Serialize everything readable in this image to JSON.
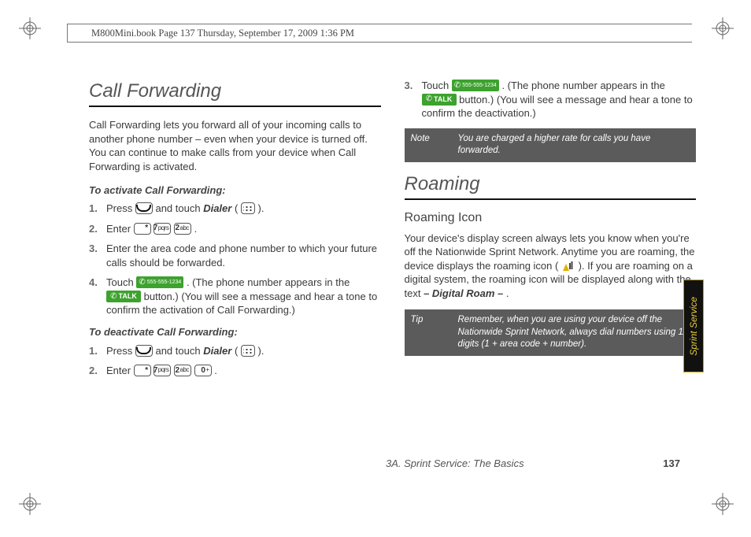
{
  "header_stamp": "M800Mini.book  Page 137  Thursday, September 17, 2009  1:36 PM",
  "left": {
    "title": "Call Forwarding",
    "intro": "Call Forwarding lets you forward all of your incoming calls to another phone number – even when your device is turned off. You can continue to make calls from your device when Call Forwarding is activated.",
    "activate_head": "To activate Call Forwarding:",
    "act": {
      "s1a": "Press ",
      "s1b": " and touch ",
      "s1c": "Dialer",
      "s1d": " (",
      "s1e": ").",
      "s2a": "Enter ",
      "s2b": ".",
      "s3": "Enter the area code and phone number to which your future calls should be forwarded.",
      "s4a": "Touch ",
      "s4b": ". (The phone number appears in the ",
      "s4c": " button.) (You will see a message and hear a tone to confirm the activation of Call Forwarding.)"
    },
    "deactivate_head": "To deactivate Call Forwarding:",
    "deact": {
      "s1a": "Press ",
      "s1b": " and touch ",
      "s1c": "Dialer",
      "s1d": " (",
      "s1e": ").",
      "s2a": "Enter ",
      "s2b": "."
    }
  },
  "right": {
    "cont": {
      "s3a": "Touch ",
      "s3b": ". (The phone number appears in the ",
      "s3c": " button.) (You will see a message and hear a tone to confirm the deactivation.)"
    },
    "note_tag": "Note",
    "note_body": "You are charged a higher rate for calls you have forwarded.",
    "title": "Roaming",
    "sub": "Roaming Icon",
    "body_a": "Your device's display screen always lets you know when you're off the Nationwide Sprint Network. Anytime you are roaming, the device displays the roaming icon (",
    "body_b": "). If you are roaming on a digital system, the roaming icon will be displayed along with the text ",
    "body_c": "– Digital Roam –",
    "body_d": ".",
    "tip_tag": "Tip",
    "tip_body": "Remember, when you are using your device off the Nationwide Sprint Network, always dial numbers using 11 digits (1 + area code + number)."
  },
  "keys": {
    "star": "*",
    "seven_d": "7",
    "seven_l": "pqrs",
    "two_d": "2",
    "two_l": "abc",
    "zero_d": "0",
    "zero_l": "+"
  },
  "callbar_label": "555-555-1234",
  "talk_label": "TALK",
  "side_tab": "Sprint Service",
  "footer_section": "3A. Sprint Service: The Basics",
  "footer_page": "137"
}
